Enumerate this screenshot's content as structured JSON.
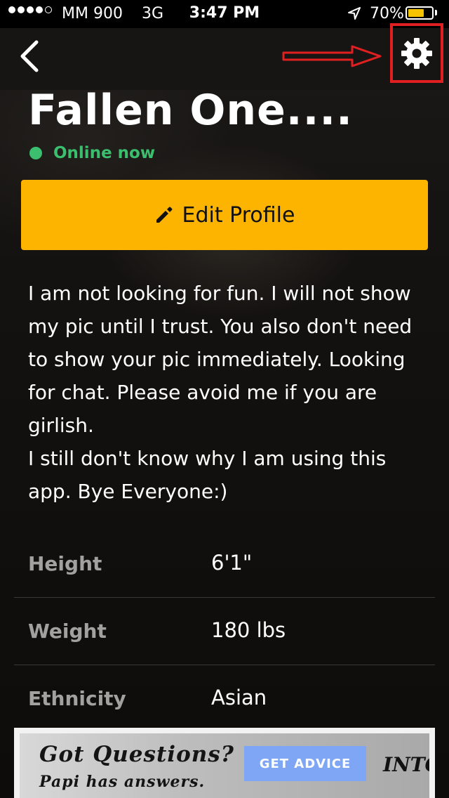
{
  "status_bar": {
    "carrier": "MM 900",
    "network": "3G",
    "time": "3:47 PM",
    "battery_percent": "70%",
    "battery_level": 0.7,
    "signal_bars_filled": 4,
    "signal_bars_total": 5
  },
  "nav": {
    "back_icon": "chevron-left-icon",
    "settings_icon": "gear-icon",
    "annotation_color": "#e02020"
  },
  "profile": {
    "name": "Fallen One....",
    "online_status": "Online now",
    "online_color": "#3bbf6e",
    "edit_button_label": "Edit Profile",
    "edit_button_color": "#fdb400",
    "bio": "I am not looking for fun. I will not show\nmy pic until I trust. You also don't need\nto show your pic immediately. Looking\nfor chat. Please avoid me if you are\ngirlish.\nI still don't know why I am using this\napp. Bye Everyone:)"
  },
  "stats": [
    {
      "label": "Height",
      "value": "6'1\""
    },
    {
      "label": "Weight",
      "value": "180 lbs"
    },
    {
      "label": "Ethnicity",
      "value": "Asian"
    }
  ],
  "ad": {
    "title": "Got Questions?",
    "subtitle": "Papi has answers.",
    "button_label": "GET ADVICE",
    "logo": "INTO"
  }
}
